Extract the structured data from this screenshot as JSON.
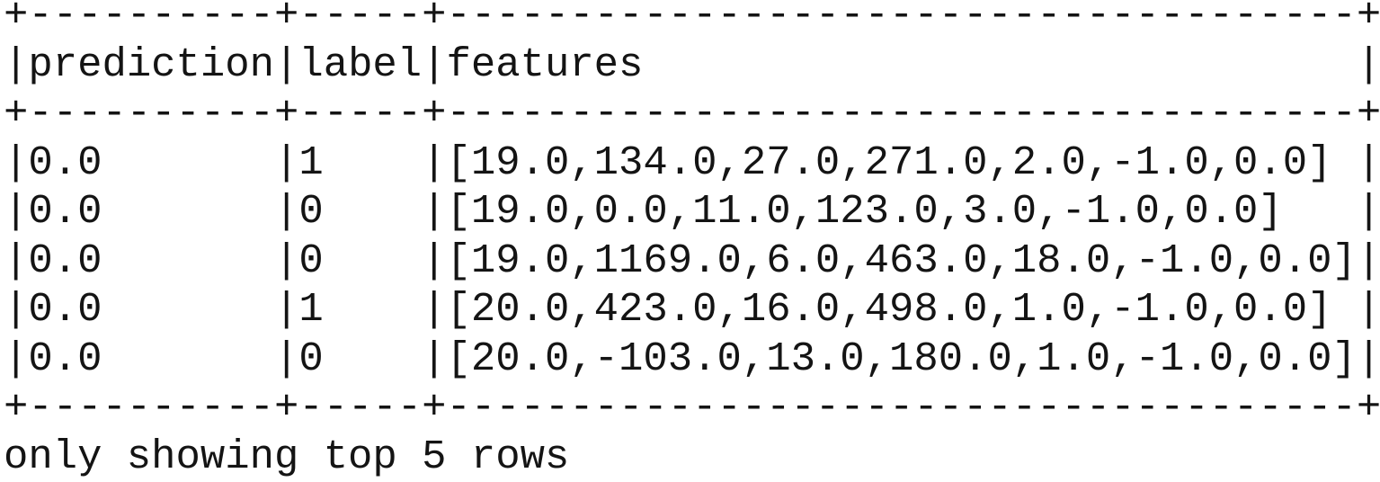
{
  "table": {
    "columns": [
      "prediction",
      "label",
      "features"
    ],
    "rows": [
      {
        "prediction": "0.0",
        "label": "1",
        "features": "[19.0,134.0,27.0,271.0,2.0,-1.0,0.0]"
      },
      {
        "prediction": "0.0",
        "label": "0",
        "features": "[19.0,0.0,11.0,123.0,3.0,-1.0,0.0]"
      },
      {
        "prediction": "0.0",
        "label": "0",
        "features": "[19.0,1169.0,6.0,463.0,18.0,-1.0,0.0]"
      },
      {
        "prediction": "0.0",
        "label": "1",
        "features": "[20.0,423.0,16.0,498.0,1.0,-1.0,0.0]"
      },
      {
        "prediction": "0.0",
        "label": "0",
        "features": "[20.0,-103.0,13.0,180.0,1.0,-1.0,0.0]"
      }
    ]
  },
  "footer": "only showing top 5 rows"
}
